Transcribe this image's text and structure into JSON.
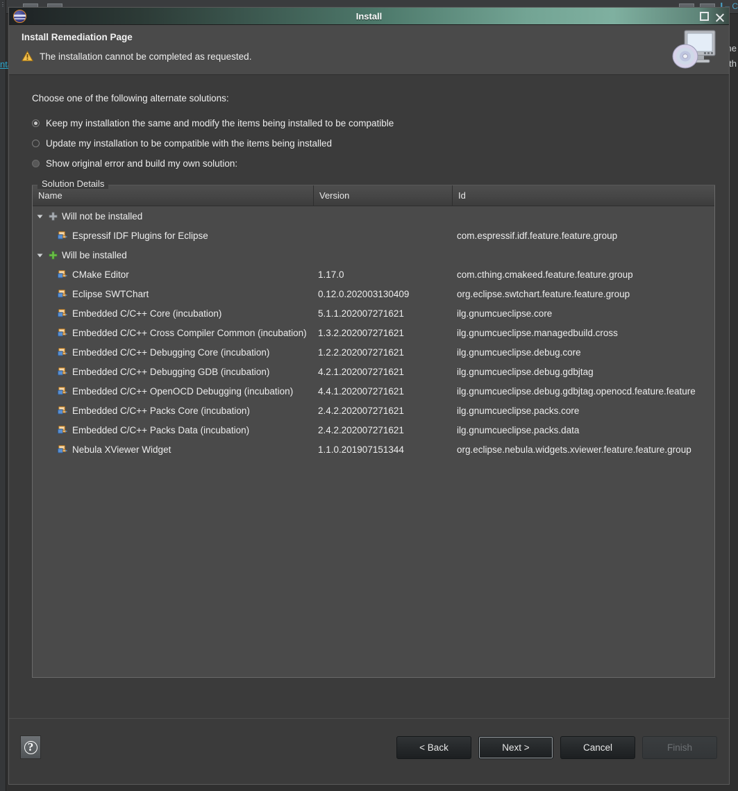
{
  "background": {
    "left_rail_text": "⋮",
    "link_text": "nta",
    "right_header_text": "❙– C",
    "right_line1": "ne",
    "right_line2": "ıth"
  },
  "window": {
    "title": "Install",
    "logo_icon": "eclipse-logo-icon",
    "maximize_icon": "maximize-icon",
    "close_icon": "close-icon"
  },
  "header": {
    "title": "Install Remediation Page",
    "message": "The installation cannot be completed as requested.",
    "warning_icon": "warning-triangle-icon",
    "banner_icon": "install-disc-monitor-icon",
    "warning_color": "#f0b429"
  },
  "body": {
    "choose_label": "Choose one of the following alternate solutions:",
    "options": [
      {
        "label": "Keep my installation the same and modify the items being installed to be compatible",
        "state": "selected"
      },
      {
        "label": "Update my installation to be compatible with the items being installed",
        "state": "unselected"
      },
      {
        "label": "Show original error and build my own solution:",
        "state": "dimmed"
      }
    ],
    "group_title": "Solution Details"
  },
  "table": {
    "columns": [
      "Name",
      "Version",
      "Id"
    ],
    "rows": [
      {
        "type": "group",
        "name": "Will not be installed",
        "version": "",
        "id": "",
        "twisty": "chevron-down-icon",
        "icon": "plus-gray-icon",
        "expanded": true
      },
      {
        "type": "item",
        "name": "Espressif IDF Plugins for Eclipse",
        "version": "",
        "id": "com.espressif.idf.feature.feature.group",
        "icon": "feature-icon"
      },
      {
        "type": "group",
        "name": "Will be installed",
        "version": "",
        "id": "",
        "twisty": "chevron-down-icon",
        "icon": "plus-green-icon",
        "expanded": true
      },
      {
        "type": "item",
        "name": "CMake Editor",
        "version": "1.17.0",
        "id": "com.cthing.cmakeed.feature.feature.group",
        "icon": "feature-icon"
      },
      {
        "type": "item",
        "name": "Eclipse SWTChart",
        "version": "0.12.0.202003130409",
        "id": "org.eclipse.swtchart.feature.feature.group",
        "icon": "feature-icon"
      },
      {
        "type": "item",
        "name": "Embedded C/C++ Core (incubation)",
        "version": "5.1.1.202007271621",
        "id": "ilg.gnumcueclipse.core",
        "icon": "feature-icon"
      },
      {
        "type": "item",
        "name": "Embedded C/C++ Cross Compiler Common (incubation)",
        "version": "1.3.2.202007271621",
        "id": "ilg.gnumcueclipse.managedbuild.cross",
        "icon": "feature-icon"
      },
      {
        "type": "item",
        "name": "Embedded C/C++ Debugging Core (incubation)",
        "version": "1.2.2.202007271621",
        "id": "ilg.gnumcueclipse.debug.core",
        "icon": "feature-icon"
      },
      {
        "type": "item",
        "name": "Embedded C/C++ Debugging GDB (incubation)",
        "version": "4.2.1.202007271621",
        "id": "ilg.gnumcueclipse.debug.gdbjtag",
        "icon": "feature-icon"
      },
      {
        "type": "item",
        "name": "Embedded C/C++ OpenOCD Debugging (incubation)",
        "version": "4.4.1.202007271621",
        "id": "ilg.gnumcueclipse.debug.gdbjtag.openocd.feature.feature",
        "icon": "feature-icon"
      },
      {
        "type": "item",
        "name": "Embedded C/C++ Packs Core (incubation)",
        "version": "2.4.2.202007271621",
        "id": "ilg.gnumcueclipse.packs.core",
        "icon": "feature-icon"
      },
      {
        "type": "item",
        "name": "Embedded C/C++ Packs Data (incubation)",
        "version": "2.4.2.202007271621",
        "id": "ilg.gnumcueclipse.packs.data",
        "icon": "feature-icon"
      },
      {
        "type": "item",
        "name": "Nebula XViewer Widget",
        "version": "1.1.0.201907151344",
        "id": "org.eclipse.nebula.widgets.xviewer.feature.feature.group",
        "icon": "feature-icon"
      }
    ]
  },
  "footer": {
    "help_icon": "help-question-icon",
    "back_label": "< Back",
    "next_label": "Next >",
    "cancel_label": "Cancel",
    "finish_label": "Finish",
    "finish_enabled": false,
    "default_button": "Next >"
  }
}
